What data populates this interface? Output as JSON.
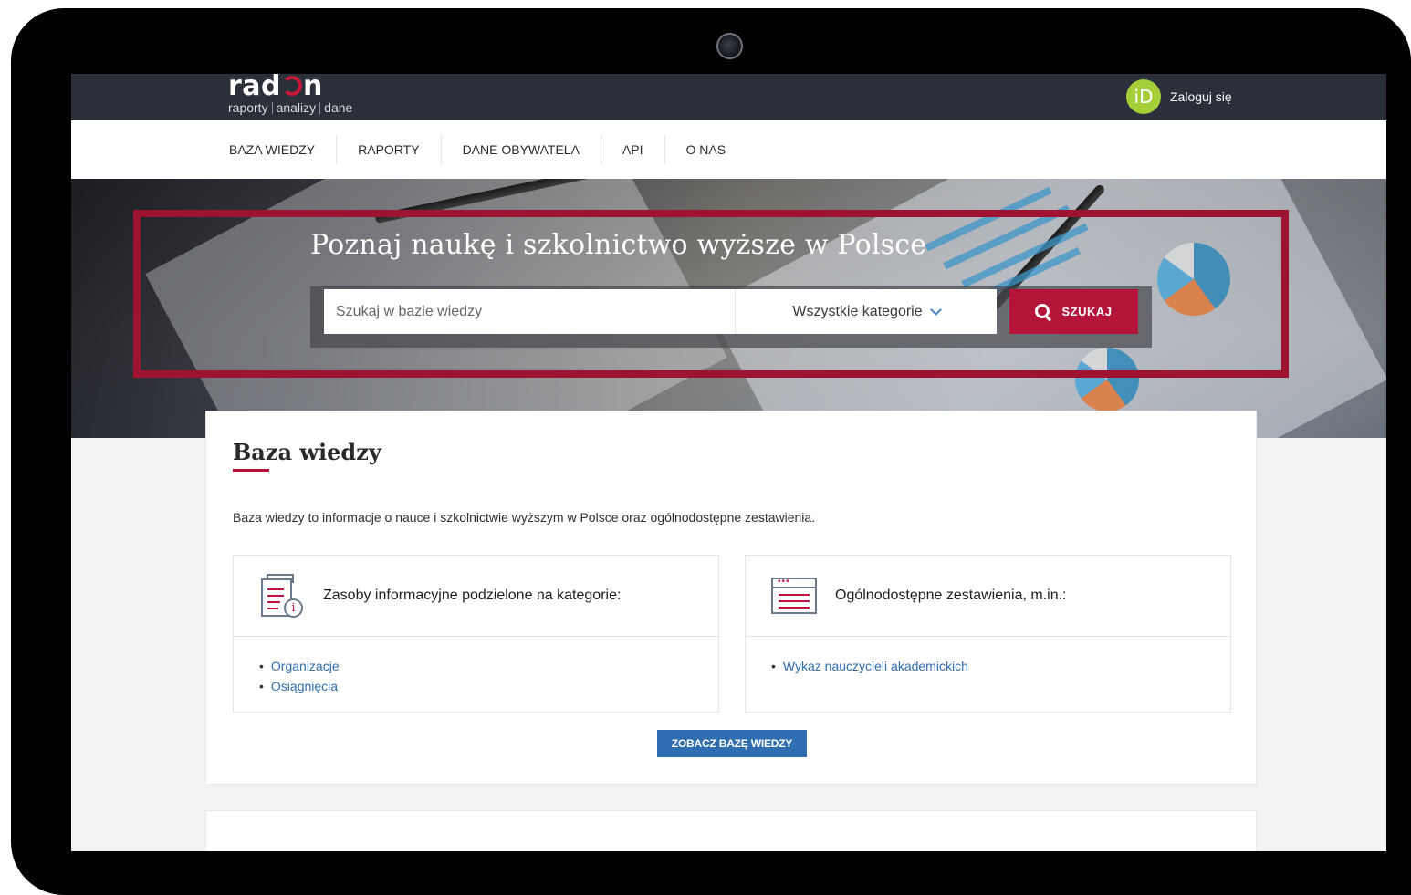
{
  "header": {
    "logo_word": "rad",
    "logo_word_end": "n",
    "logo_sub": [
      "raporty",
      "analizy",
      "dane"
    ],
    "login_icon_text": "iD",
    "login_label": "Zaloguj się"
  },
  "nav": {
    "items": [
      {
        "label": "BAZA WIEDZY"
      },
      {
        "label": "RAPORTY"
      },
      {
        "label": "DANE OBYWATELA"
      },
      {
        "label": "API"
      },
      {
        "label": "O NAS"
      }
    ]
  },
  "hero": {
    "title": "Poznaj naukę i szkolnictwo wyższe w Polsce",
    "search_placeholder": "Szukaj w bazie wiedzy",
    "category_value": "Wszystkie kategorie",
    "search_button": "SZUKAJ"
  },
  "knowledge_base": {
    "title": "Baza wiedzy",
    "description": "Baza wiedzy to informacje o nauce i szkolnictwie wyższym w Polsce oraz ogólnodostępne zestawienia.",
    "panels": [
      {
        "title": "Zasoby informacyjne podzielone na kategorie:",
        "icon": "document-info-icon",
        "links": [
          "Organizacje",
          "Osiągnięcia"
        ]
      },
      {
        "title": "Ogólnodostępne zestawienia, m.in.:",
        "icon": "list-window-icon",
        "links": [
          "Wykaz nauczycieli akademickich"
        ]
      }
    ],
    "cta": "ZOBACZ BAZĘ WIEDZY"
  },
  "colors": {
    "accent_red": "#b5143a",
    "link_blue": "#2f6eb0",
    "topbar": "#2a2f3a",
    "orcid_green": "#a6ce39"
  }
}
